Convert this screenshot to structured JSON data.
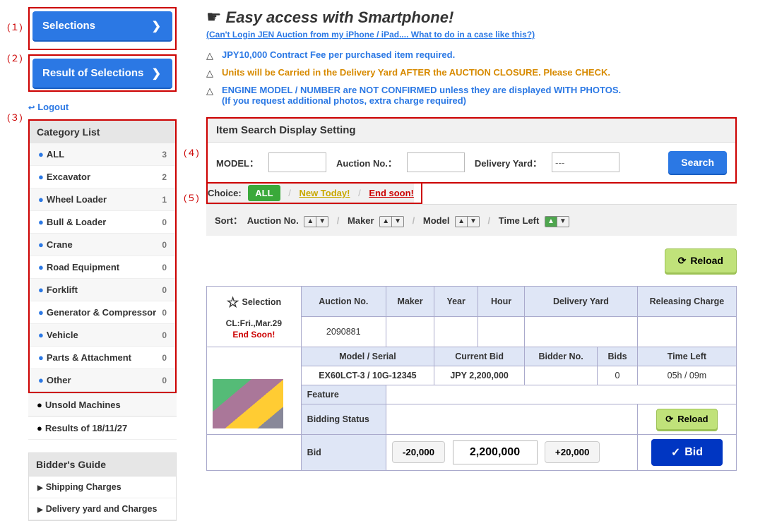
{
  "annotations": {
    "a1": "(１)",
    "a2": "(２)",
    "a3": "(３)",
    "a4": "(４)",
    "a5": "(５)"
  },
  "sidebar": {
    "selections_label": "Selections",
    "results_label": "Result of Selections",
    "logout": "Logout"
  },
  "categoryHeader": "Category List",
  "categories": [
    {
      "name": "ALL",
      "count": "3"
    },
    {
      "name": "Excavator",
      "count": "2"
    },
    {
      "name": "Wheel Loader",
      "count": "1"
    },
    {
      "name": "Bull & Loader",
      "count": "0"
    },
    {
      "name": "Crane",
      "count": "0"
    },
    {
      "name": "Road Equipment",
      "count": "0"
    },
    {
      "name": "Forklift",
      "count": "0"
    },
    {
      "name": "Generator & Compressor",
      "count": "0"
    },
    {
      "name": "Vehicle",
      "count": "0"
    },
    {
      "name": "Parts & Attachment",
      "count": "0"
    },
    {
      "name": "Other",
      "count": "0"
    }
  ],
  "extraCats": [
    {
      "name": "Unsold Machines"
    },
    {
      "name": "Results of 18/11/27"
    }
  ],
  "bidderGuide": {
    "header": "Bidder's Guide",
    "items": [
      "Shipping Charges",
      "Delivery yard and Charges"
    ]
  },
  "smartphone": {
    "title": "Easy access with Smartphone!",
    "help": "(Can't Login JEN Auction from my iPhone / iPad.... What to do in a case like this?)"
  },
  "notices": [
    {
      "text": "JPY10,000 Contract Fee per purchased item required.",
      "cls": "notice-blue"
    },
    {
      "text": "Units will be Carried in the Delivery Yard AFTER the AUCTION CLOSURE. Please CHECK.",
      "cls": "notice-orange"
    },
    {
      "text": "ENGINE MODEL / NUMBER are NOT CONFIRMED unless they are displayed WITH PHOTOS.",
      "cls": "notice-blue",
      "sub": "(If you request additional photos, extra charge required)"
    }
  ],
  "search": {
    "header": "Item Search Display Setting",
    "model": "MODEL：",
    "auctionNo": "Auction No.：",
    "deliveryYard": "Delivery Yard：",
    "yardPlaceholder": "---",
    "button": "Search"
  },
  "choice": {
    "label": "Choice:",
    "all": "ALL",
    "newToday": "New Today!",
    "endSoon": "End soon!"
  },
  "sort": {
    "label": "Sort：",
    "auctionNo": "Auction No.",
    "maker": "Maker",
    "model": "Model",
    "timeLeft": "Time Left"
  },
  "reload": "Reload",
  "tableHeaders": {
    "selection": "Selection",
    "auctionNo": "Auction No.",
    "maker": "Maker",
    "year": "Year",
    "hour": "Hour",
    "deliveryYard": "Delivery Yard",
    "releasingCharge": "Releasing Charge",
    "modelSerial": "Model / Serial",
    "currentBid": "Current Bid",
    "bidderNo": "Bidder No.",
    "bids": "Bids",
    "timeLeft": "Time Left",
    "feature": "Feature",
    "biddingStatus": "Bidding Status",
    "bid": "Bid"
  },
  "item": {
    "closingLine": "CL:Fri.,Mar.29",
    "endSoon": "End Soon!",
    "auctionNo": "2090881",
    "modelSerial": "EX60LCT-3 / 10G-12345",
    "currentBid": "JPY 2,200,000",
    "bids": "0",
    "timeLeft": "05h / 09m",
    "stepDown": "-20,000",
    "stepUp": "+20,000",
    "bidValue": "2,200,000",
    "bidBtn": "Bid"
  }
}
